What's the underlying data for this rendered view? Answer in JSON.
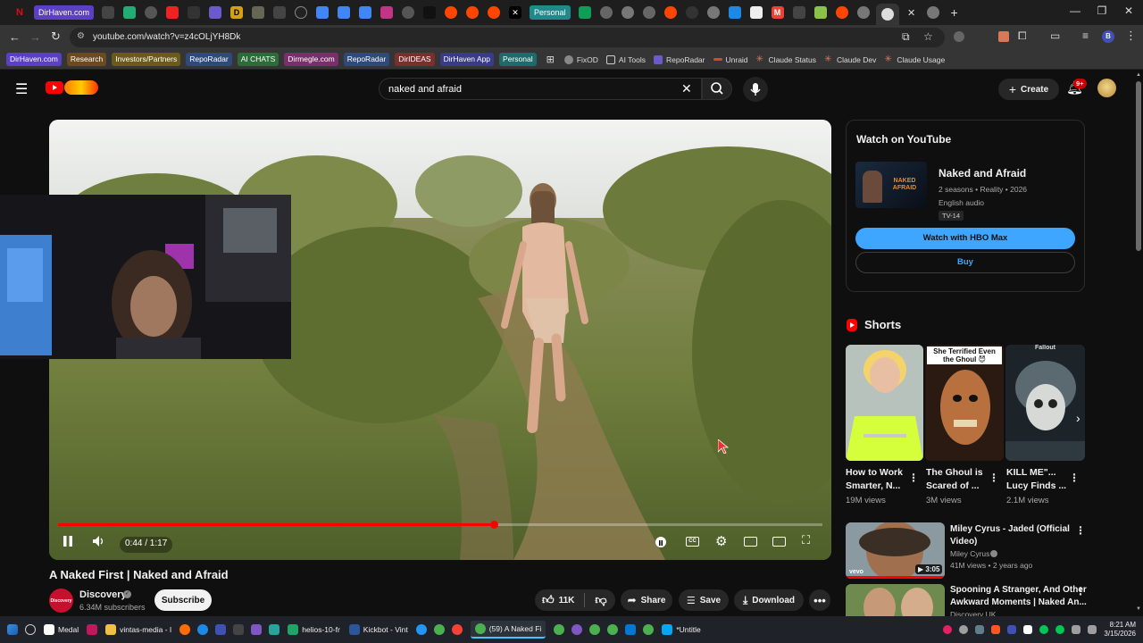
{
  "browser": {
    "tab_pills": [
      "DirHaven.com",
      "Personal"
    ],
    "url": "youtube.com/watch?v=z4cOLjYH8Dk"
  },
  "bookmarks": {
    "pills": [
      {
        "label": "DirHaven.com",
        "color": "#5b3fc4"
      },
      {
        "label": "Research",
        "color": "#6b4a1f"
      },
      {
        "label": "Investors/Partners",
        "color": "#6b5a1a"
      },
      {
        "label": "RepoRadar",
        "color": "#2f4a7a"
      },
      {
        "label": "AI CHATS",
        "color": "#2e6b3a"
      },
      {
        "label": "Dirmegle.com",
        "color": "#7a2f6b"
      },
      {
        "label": "RepoRadar",
        "color": "#2f4a7a"
      },
      {
        "label": "DirIDEAS",
        "color": "#7a2f2f"
      },
      {
        "label": "DirHaven App",
        "color": "#3a3a8a"
      },
      {
        "label": "Personal",
        "color": "#1f6b6b"
      }
    ],
    "plain": [
      "FixOD",
      "AI Tools",
      "RepoRadar",
      "Unraid",
      "Claude Status",
      "Claude Dev",
      "Claude Usage"
    ]
  },
  "youtube": {
    "search_value": "naked and afraid",
    "create_label": "Create",
    "notification_count": "9+"
  },
  "player": {
    "time": "0:44 / 1:17",
    "progress": 0.57
  },
  "video": {
    "title": "A Naked First | Naked and Afraid",
    "channel": "Discovery",
    "subscribers": "6.34M subscribers",
    "subscribe_label": "Subscribe",
    "channel_logo_text": "Discovery",
    "likes": "11K",
    "share_label": "Share",
    "save_label": "Save",
    "download_label": "Download"
  },
  "watch_card": {
    "heading": "Watch on YouTube",
    "show_title": "Naked and Afraid",
    "meta": "2 seasons • Reality • 2026",
    "audio": "English audio",
    "rating": "TV-14",
    "poster_text": "NAKED AFRAID",
    "primary_button": "Watch with HBO Max",
    "secondary_button": "Buy"
  },
  "shorts": {
    "heading": "Shorts",
    "items": [
      {
        "title_line1": "How to Work",
        "title_line2": "Smarter, N...",
        "views": "19M views"
      },
      {
        "title_line1": "The Ghoul is",
        "title_line2": "Scared of ...",
        "views": "3M views",
        "overlay": "She Terrified Even the Ghoul 😈"
      },
      {
        "title_line1": "KILL ME\"...",
        "title_line2": "Lucy Finds ...",
        "views": "2.1M views",
        "overlay": "Fallout"
      }
    ]
  },
  "related": [
    {
      "title_line1": "Miley Cyrus - Jaded (Official",
      "title_line2": "Video)",
      "channel": "Miley Cyrus",
      "meta": "41M views • 2 years ago",
      "duration": "3:05",
      "badge": "vevo"
    },
    {
      "title_line1": "Spooning A Stranger, And Other",
      "title_line2": "Awkward Moments | Naked An...",
      "channel": "Discovery UK",
      "meta": "",
      "duration": ""
    }
  ],
  "taskbar": {
    "apps": [
      "Medal",
      "vintas-media - I",
      "helios-10-fr",
      "Kickbot - Vint",
      "(59) A Naked Fi",
      "*Untitle"
    ],
    "time": "8:21 AM",
    "date": "3/15/2026"
  }
}
